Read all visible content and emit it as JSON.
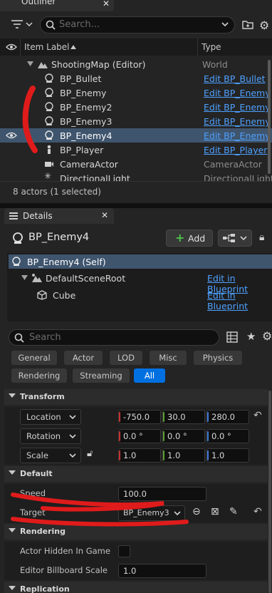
{
  "outliner": {
    "tab_title": "Outliner",
    "search_placeholder": "Search...",
    "columns": {
      "item_label": "Item Label",
      "type": "Type"
    },
    "rows": [
      {
        "label": "ShootingMap (Editor)",
        "type": "World",
        "type_is_link": false
      },
      {
        "label": "BP_Bullet",
        "type": "Edit BP_Bullet",
        "type_is_link": true
      },
      {
        "label": "BP_Enemy",
        "type": "Edit BP_Enemy",
        "type_is_link": true
      },
      {
        "label": "BP_Enemy2",
        "type": "Edit BP_Enemy",
        "type_is_link": true
      },
      {
        "label": "BP_Enemy3",
        "type": "Edit BP_Enemy",
        "type_is_link": true
      },
      {
        "label": "BP_Enemy4",
        "type": "Edit BP_Enemy",
        "type_is_link": true,
        "selected": true
      },
      {
        "label": "BP_Player",
        "type": "Edit BP_Player",
        "type_is_link": true
      },
      {
        "label": "CameraActor",
        "type": "CameraActor",
        "type_is_link": false
      },
      {
        "label": "DirectionalLight",
        "type": "DirectionalLight",
        "type_is_link": false
      }
    ],
    "status": "8 actors (1 selected)"
  },
  "details": {
    "tab_title": "Details",
    "actor_name": "BP_Enemy4",
    "add_button": "Add",
    "components": [
      {
        "label": "BP_Enemy4 (Self)",
        "link": ""
      },
      {
        "label": "DefaultSceneRoot",
        "link": "Edit in Blueprint"
      },
      {
        "label": "Cube",
        "link": "Edit in Blueprint"
      }
    ],
    "search_placeholder": "Search",
    "filters_row1": [
      "General",
      "Actor",
      "LOD",
      "Misc",
      "Physics"
    ],
    "filters_row2": [
      "Rendering",
      "Streaming",
      "All"
    ],
    "active_filter": "All",
    "sections": {
      "transform": "Transform",
      "default": "Default",
      "rendering": "Rendering",
      "replication": "Replication"
    },
    "transform": {
      "location": {
        "mode": "Location",
        "x": "-750.0",
        "y": "30.0",
        "z": "280.0"
      },
      "rotation": {
        "mode": "Rotation",
        "x": "0.0 °",
        "y": "0.0 °",
        "z": "0.0 °"
      },
      "scale": {
        "mode": "Scale",
        "x": "1.0",
        "y": "1.0",
        "z": "1.0"
      }
    },
    "default_props": {
      "speed_label": "Speed",
      "speed_value": "100.0",
      "target_label": "Target",
      "target_value": "BP_Enemy3"
    },
    "rendering_props": {
      "hidden_label": "Actor Hidden In Game",
      "hidden_checked": false,
      "billboard_label": "Editor Billboard Scale",
      "billboard_value": "1.0"
    }
  },
  "colors": {
    "accent": "#0070e0",
    "link": "#4ea1ff",
    "selection": "#3f556e",
    "annotation": "#e01b1b",
    "axis_x": "#c83232",
    "axis_y": "#5aa032",
    "axis_z": "#3c78d8"
  }
}
